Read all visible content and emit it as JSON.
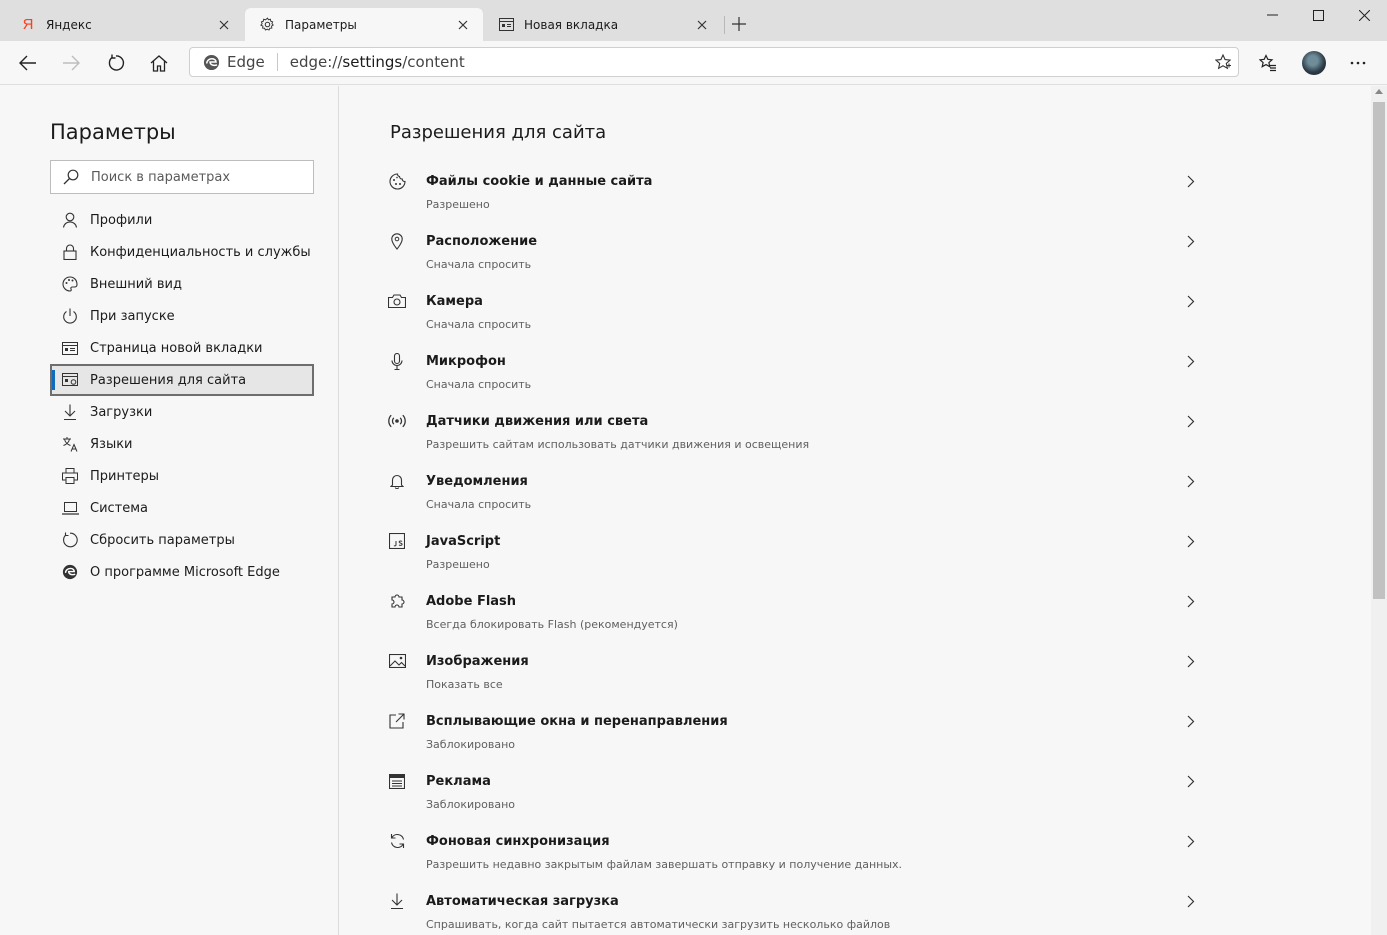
{
  "tabs": [
    {
      "title": "Яндекс",
      "icon": "yandex-icon",
      "icon_text": "Я"
    },
    {
      "title": "Параметры",
      "icon": "gear-icon"
    },
    {
      "title": "Новая вкладка",
      "icon": "new-tab-page-icon"
    }
  ],
  "address": {
    "edge_label": "Edge",
    "url_prefix": "edge://",
    "url_host": "settings",
    "url_path": "/content"
  },
  "sidebar": {
    "title": "Параметры",
    "search_placeholder": "Поиск в параметрах",
    "items": [
      {
        "label": "Профили",
        "icon": "profile-icon"
      },
      {
        "label": "Конфиденциальность и службы",
        "icon": "lock-icon"
      },
      {
        "label": "Внешний вид",
        "icon": "palette-icon"
      },
      {
        "label": "При запуске",
        "icon": "power-icon"
      },
      {
        "label": "Страница новой вкладки",
        "icon": "new-tab-page-icon"
      },
      {
        "label": "Разрешения для сайта",
        "icon": "site-permissions-icon",
        "selected": true
      },
      {
        "label": "Загрузки",
        "icon": "download-icon"
      },
      {
        "label": "Языки",
        "icon": "languages-icon"
      },
      {
        "label": "Принтеры",
        "icon": "printer-icon"
      },
      {
        "label": "Система",
        "icon": "laptop-icon"
      },
      {
        "label": "Сбросить параметры",
        "icon": "reset-icon"
      },
      {
        "label": "О программе Microsoft Edge",
        "icon": "edge-logo-icon"
      }
    ]
  },
  "main": {
    "title": "Разрешения для сайта",
    "permissions": [
      {
        "title": "Файлы cookie и данные сайта",
        "status": "Разрешено",
        "icon": "cookie-icon"
      },
      {
        "title": "Расположение",
        "status": "Сначала спросить",
        "icon": "location-pin-icon"
      },
      {
        "title": "Камера",
        "status": "Сначала спросить",
        "icon": "camera-icon"
      },
      {
        "title": "Микрофон",
        "status": "Сначала спросить",
        "icon": "microphone-icon"
      },
      {
        "title": "Датчики движения или света",
        "status": "Разрешить сайтам использовать датчики движения и освещения",
        "icon": "sensor-icon"
      },
      {
        "title": "Уведомления",
        "status": "Сначала спросить",
        "icon": "bell-icon"
      },
      {
        "title": "JavaScript",
        "status": "Разрешено",
        "icon": "javascript-icon"
      },
      {
        "title": "Adobe Flash",
        "status": "Всегда блокировать Flash (рекомендуется)",
        "icon": "puzzle-icon"
      },
      {
        "title": "Изображения",
        "status": "Показать все",
        "icon": "image-icon"
      },
      {
        "title": "Всплывающие окна и перенаправления",
        "status": "Заблокировано",
        "icon": "popup-icon"
      },
      {
        "title": "Реклама",
        "status": "Заблокировано",
        "icon": "ads-icon"
      },
      {
        "title": "Фоновая синхронизация",
        "status": "Разрешить недавно закрытым файлам завершать отправку и получение данных.",
        "icon": "sync-icon"
      },
      {
        "title": "Автоматическая загрузка",
        "status": "Спрашивать, когда сайт пытается автоматически загрузить несколько файлов",
        "icon": "download-icon"
      }
    ]
  },
  "colors": {
    "accent": "#0f6cbd",
    "yandex_red": "#fc3f1d",
    "tab_strip": "#dfdfdf",
    "page_bg": "#f7f7f7"
  }
}
